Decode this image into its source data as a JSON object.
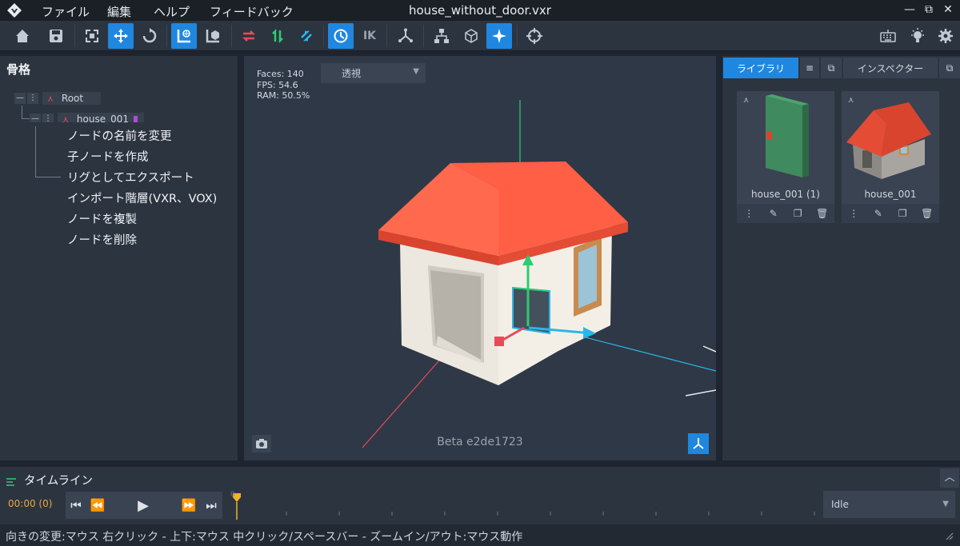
{
  "window": {
    "title": "house_without_door.vxr",
    "menu": [
      "ファイル",
      "編集",
      "ヘルプ",
      "フィードバック"
    ],
    "controls": [
      "—",
      "⧉",
      "✕"
    ]
  },
  "toolbar": {
    "icons": [
      "home-icon",
      "save-icon",
      "fit-icon",
      "move-icon",
      "rotate-icon",
      "world-space-icon",
      "local-space-icon",
      "swap-red-icon",
      "swap-green-icon",
      "swap-blue-icon",
      "rotate-gizmo-icon",
      "ik-icon",
      "bone-icon",
      "hierarchy-icon",
      "cube-icon",
      "sparkle-icon",
      "target-icon",
      "keyboard-icon",
      "light-icon",
      "settings-icon"
    ],
    "ik_label": "IK",
    "accent": "#1f87e0"
  },
  "skeleton": {
    "title": "骨格",
    "root_label": "Root",
    "child_label": "house_001",
    "context_menu": [
      "ノードの名前を変更",
      "子ノードを作成",
      "リグとしてエクスポート",
      "インポート階層(VXR、VOX)",
      "ノードを複製",
      "ノードを削除"
    ]
  },
  "viewport": {
    "stats": [
      "Faces: 140",
      "FPS: 54.6",
      "RAM: 50.5%"
    ],
    "view_mode": "透視",
    "build": "Beta e2de1723"
  },
  "library": {
    "tabs": [
      "ライブラリ",
      "インスペクター"
    ],
    "items": [
      {
        "name": "house_001 (1)"
      },
      {
        "name": "house_001"
      }
    ]
  },
  "timeline": {
    "title": "タイムライン",
    "time": "00:00 (0)",
    "frame_marker": "0",
    "animation": "Idle"
  },
  "status": {
    "text": "向きの変更:マウス 右クリック - 上下:マウス 中クリック/スペースバー - ズームイン/アウト:マウス動作"
  }
}
